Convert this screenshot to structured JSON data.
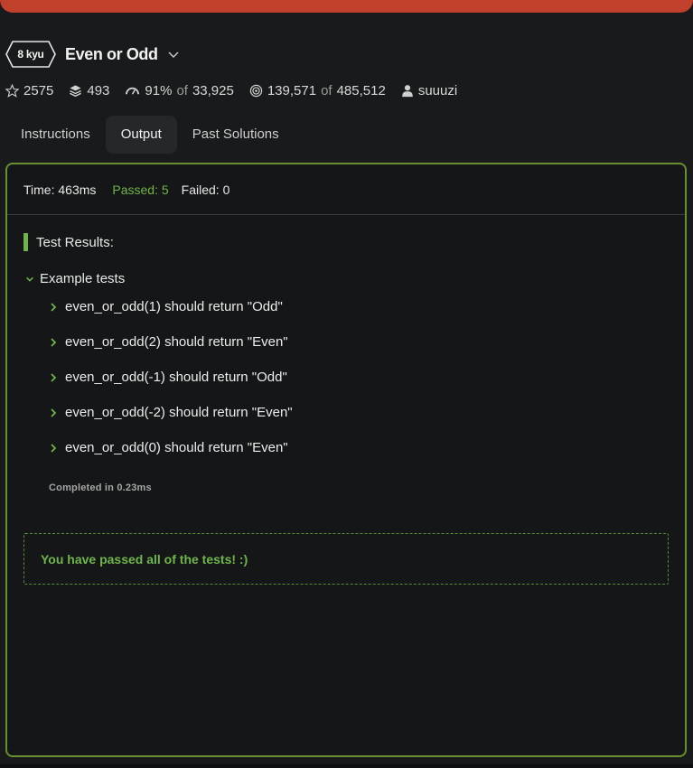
{
  "kata": {
    "rank": "8 kyu",
    "title": "Even or Odd"
  },
  "stats": {
    "stars": "2575",
    "collections": "493",
    "satisfaction_pct": "91%",
    "satisfaction_of": "of",
    "satisfaction_votes": "33,925",
    "completed": "139,571",
    "completed_of": "of",
    "attempts": "485,512",
    "author": "suuuzi"
  },
  "tabs": [
    {
      "label": "Instructions"
    },
    {
      "label": "Output"
    },
    {
      "label": "Past Solutions"
    }
  ],
  "output": {
    "time": "Time: 463ms",
    "passed": "Passed: 5",
    "failed": "Failed: 0",
    "results_title": "Test Results:",
    "group_label": "Example tests",
    "tests": [
      "even_or_odd(1) should return \"Odd\"",
      "even_or_odd(2) should return \"Even\"",
      "even_or_odd(-1) should return \"Odd\"",
      "even_or_odd(-2) should return \"Even\"",
      "even_or_odd(0) should return \"Even\""
    ],
    "completed": "Completed in 0.23ms",
    "success_message": "You have passed all of the tests! :)"
  },
  "colors": {
    "banner": "#c0402b",
    "accent_green": "#6fb54a",
    "panel_border": "#6b8f2e",
    "background": "#181a1b"
  }
}
